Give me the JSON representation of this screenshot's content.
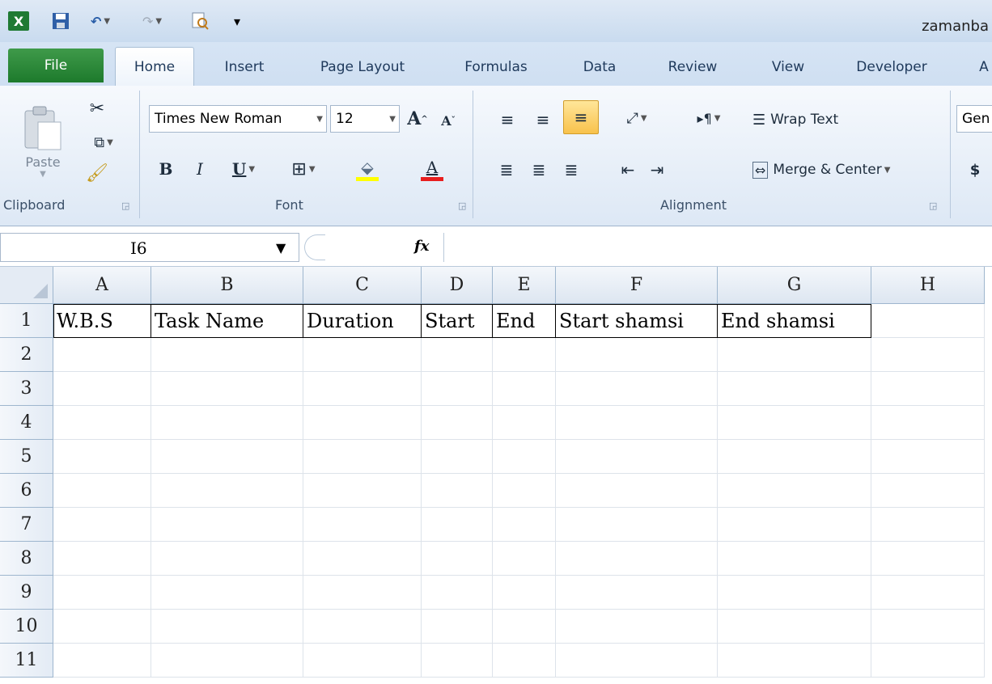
{
  "window": {
    "title": "zamanba"
  },
  "qat": {
    "excel_icon": "X",
    "undo": "↶",
    "redo": "↷",
    "preview": "🔍",
    "customize": "▾"
  },
  "tabs": [
    {
      "label": "File"
    },
    {
      "label": "Home"
    },
    {
      "label": "Insert"
    },
    {
      "label": "Page Layout"
    },
    {
      "label": "Formulas"
    },
    {
      "label": "Data"
    },
    {
      "label": "Review"
    },
    {
      "label": "View"
    },
    {
      "label": "Developer"
    },
    {
      "label": "A"
    }
  ],
  "ribbon": {
    "clipboard": {
      "label": "Clipboard",
      "paste": "Paste"
    },
    "font": {
      "label": "Font",
      "family": "Times New Roman",
      "size": "12",
      "bold": "B",
      "italic": "I",
      "underline": "U",
      "grow": "A",
      "shrink": "A",
      "font_color": "A"
    },
    "alignment": {
      "label": "Alignment",
      "wrap_text": "Wrap Text",
      "merge_center": "Merge & Center"
    },
    "number": {
      "format": "Gen",
      "currency": "$"
    }
  },
  "formula_bar": {
    "name_box": "I6",
    "fx": "fx",
    "value": ""
  },
  "grid": {
    "columns": [
      "A",
      "B",
      "C",
      "D",
      "E",
      "F",
      "G",
      "H"
    ],
    "rows": [
      "1",
      "2",
      "3",
      "4",
      "5",
      "6",
      "7",
      "8",
      "9",
      "10",
      "11"
    ],
    "row1": [
      "W.B.S",
      "Task Name",
      "Duration",
      "Start",
      "End",
      "Start shamsi",
      "End shamsi"
    ]
  }
}
